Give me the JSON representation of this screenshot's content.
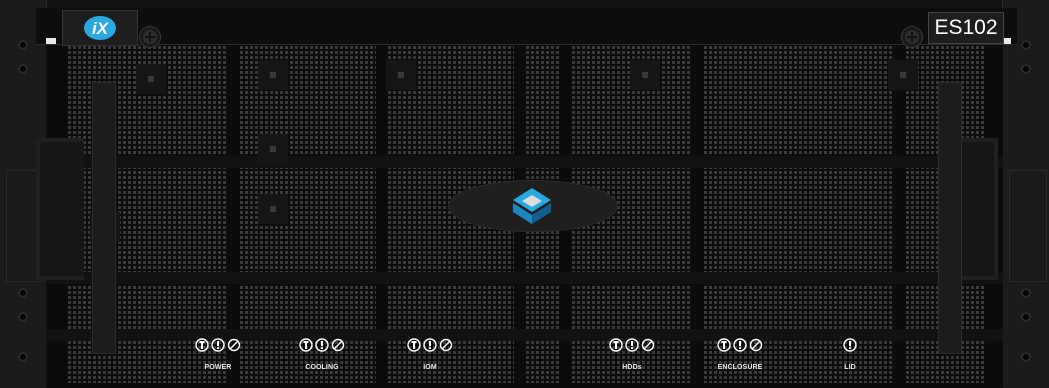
{
  "enclosure": {
    "logo_text": "iX",
    "model": "ES102",
    "accent_color": "#29a9e0"
  },
  "indicators": [
    {
      "key": "power",
      "label": "POWER",
      "icons": [
        "identify-icon",
        "fault-icon",
        "disabled-icon"
      ]
    },
    {
      "key": "cooling",
      "label": "COOLING",
      "icons": [
        "identify-icon",
        "fault-icon",
        "disabled-icon"
      ]
    },
    {
      "key": "iom",
      "label": "IOM",
      "icons": [
        "identify-icon",
        "fault-icon",
        "disabled-icon"
      ]
    },
    {
      "key": "hdds",
      "label": "HDDs",
      "icons": [
        "identify-icon",
        "fault-icon",
        "disabled-icon"
      ]
    },
    {
      "key": "enclosure",
      "label": "ENCLOSURE",
      "icons": [
        "identify-icon",
        "fault-icon",
        "disabled-icon"
      ]
    },
    {
      "key": "lid",
      "label": "LID",
      "icons": [
        "fault-icon"
      ]
    }
  ]
}
